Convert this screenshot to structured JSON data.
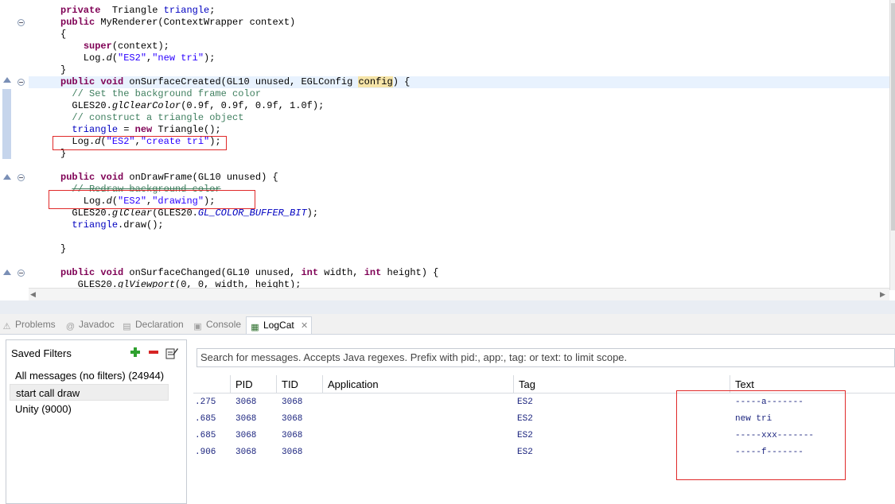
{
  "editor": {
    "lines": [
      {
        "id": "l1",
        "parts": [
          [
            "kw",
            "private"
          ],
          [
            "",
            "  Triangle "
          ],
          [
            "fld",
            "triangle"
          ],
          [
            "",
            ";"
          ]
        ]
      },
      {
        "id": "l2",
        "parts": [
          [
            "kw",
            "public"
          ],
          [
            "",
            " MyRenderer(ContextWrapper context)"
          ]
        ]
      },
      {
        "id": "l3",
        "parts": [
          [
            "",
            "{"
          ]
        ]
      },
      {
        "id": "l4",
        "parts": [
          [
            "",
            "    "
          ],
          [
            "kw",
            "super"
          ],
          [
            "",
            "(context);"
          ]
        ]
      },
      {
        "id": "l5",
        "parts": [
          [
            "",
            "    Log."
          ],
          [
            "ital",
            "d"
          ],
          [
            "",
            "("
          ],
          [
            "str",
            "\"ES2\""
          ],
          [
            "",
            ","
          ],
          [
            "str",
            "\"new tri\""
          ],
          [
            "",
            ");"
          ]
        ]
      },
      {
        "id": "l6",
        "parts": [
          [
            "",
            "}"
          ]
        ]
      },
      {
        "id": "l7",
        "parts": [
          [
            "kw",
            "public"
          ],
          [
            "",
            " "
          ],
          [
            "kw",
            "void"
          ],
          [
            "",
            " onSurfaceCreated(GL10 unused, EGLConfig "
          ],
          [
            "occ",
            "config"
          ],
          [
            "",
            ") {"
          ]
        ]
      },
      {
        "id": "l8",
        "parts": [
          [
            "",
            "  "
          ],
          [
            "cm",
            "// Set the background frame color"
          ]
        ]
      },
      {
        "id": "l9",
        "parts": [
          [
            "",
            "  GLES20."
          ],
          [
            "ital",
            "glClearColor"
          ],
          [
            "",
            "(0.9f, 0.9f, 0.9f, 1.0f);"
          ]
        ]
      },
      {
        "id": "l10",
        "parts": [
          [
            "",
            "  "
          ],
          [
            "cm",
            "// construct a triangle object"
          ]
        ]
      },
      {
        "id": "l11",
        "parts": [
          [
            "",
            "  "
          ],
          [
            "fld",
            "triangle"
          ],
          [
            "",
            " = "
          ],
          [
            "kw",
            "new"
          ],
          [
            "",
            " Triangle();"
          ]
        ]
      },
      {
        "id": "l12",
        "parts": [
          [
            "",
            "  Log."
          ],
          [
            "ital",
            "d"
          ],
          [
            "",
            "("
          ],
          [
            "str",
            "\"ES2\""
          ],
          [
            "",
            ","
          ],
          [
            "str",
            "\"create tri\""
          ],
          [
            "",
            ");"
          ]
        ]
      },
      {
        "id": "l13",
        "parts": [
          [
            "",
            "}"
          ]
        ]
      },
      {
        "id": "l14",
        "parts": []
      },
      {
        "id": "l15",
        "parts": [
          [
            "kw",
            "public"
          ],
          [
            "",
            " "
          ],
          [
            "kw",
            "void"
          ],
          [
            "",
            " onDrawFrame(GL10 unused) {"
          ]
        ]
      },
      {
        "id": "l16",
        "parts": [
          [
            "",
            "  "
          ],
          [
            "cm strike",
            "// Redraw background color"
          ]
        ]
      },
      {
        "id": "l17",
        "parts": [
          [
            "",
            "    Log."
          ],
          [
            "ital",
            "d"
          ],
          [
            "",
            "("
          ],
          [
            "str",
            "\"ES2\""
          ],
          [
            "",
            ","
          ],
          [
            "str",
            "\"drawing\""
          ],
          [
            "",
            ");"
          ]
        ]
      },
      {
        "id": "l18",
        "parts": [
          [
            "",
            "  GLES20."
          ],
          [
            "ital",
            "glClear"
          ],
          [
            "",
            "(GLES20."
          ],
          [
            "const",
            "GL_COLOR_BUFFER_BIT"
          ],
          [
            "",
            ");"
          ]
        ]
      },
      {
        "id": "l19",
        "parts": [
          [
            "",
            "  "
          ],
          [
            "fld",
            "triangle"
          ],
          [
            "",
            ".draw();"
          ]
        ]
      },
      {
        "id": "l20",
        "parts": []
      },
      {
        "id": "l21",
        "parts": [
          [
            "",
            "}"
          ]
        ]
      },
      {
        "id": "l22",
        "parts": []
      },
      {
        "id": "l23",
        "parts": [
          [
            "kw",
            "public"
          ],
          [
            "",
            " "
          ],
          [
            "kw",
            "void"
          ],
          [
            "",
            " onSurfaceChanged(GL10 unused, "
          ],
          [
            "kw",
            "int"
          ],
          [
            "",
            " width, "
          ],
          [
            "kw",
            "int"
          ],
          [
            "",
            " height) {"
          ]
        ]
      },
      {
        "id": "l24",
        "parts": [
          [
            "",
            "   GLES20."
          ],
          [
            "ital",
            "glViewport"
          ],
          [
            "",
            "(0, 0, width, height);"
          ]
        ]
      }
    ]
  },
  "tabs": [
    {
      "label": "Problems",
      "icon": "problems-icon",
      "active": false
    },
    {
      "label": "Javadoc",
      "icon": "javadoc-icon",
      "active": false
    },
    {
      "label": "Declaration",
      "icon": "declaration-icon",
      "active": false
    },
    {
      "label": "Console",
      "icon": "console-icon",
      "active": false
    },
    {
      "label": "LogCat",
      "icon": "logcat-icon",
      "active": true
    }
  ],
  "filters": {
    "title": "Saved Filters",
    "items": [
      "All messages (no filters) (24944)",
      "start call draw",
      "Unity (9000)"
    ],
    "selected_index": 1
  },
  "search": {
    "placeholder": "Search for messages. Accepts Java regexes. Prefix with pid:, app:, tag: or text: to limit scope."
  },
  "log": {
    "columns": [
      "PID",
      "TID",
      "Application",
      "Tag",
      "Text"
    ],
    "rows": [
      {
        "time": ".275",
        "pid": "3068",
        "tid": "3068",
        "app": "",
        "tag": "ES2",
        "text": "-----a-------"
      },
      {
        "time": ".685",
        "pid": "3068",
        "tid": "3068",
        "app": "",
        "tag": "ES2",
        "text": "new tri"
      },
      {
        "time": ".685",
        "pid": "3068",
        "tid": "3068",
        "app": "",
        "tag": "ES2",
        "text": "-----xxx-------"
      },
      {
        "time": ".906",
        "pid": "3068",
        "tid": "3068",
        "app": "",
        "tag": "ES2",
        "text": "-----f-------"
      }
    ]
  },
  "colors": {
    "annotation_box": "#e02a2a",
    "keyword": "#7f0055",
    "string": "#2a00ff",
    "comment": "#3f7f5f",
    "field": "#0000c0",
    "log_text": "#1a237e"
  }
}
